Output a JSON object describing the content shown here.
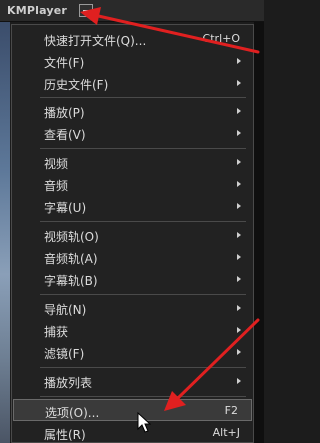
{
  "window": {
    "title": "KMPlayer"
  },
  "menu": {
    "items": [
      {
        "label": "快速打开文件(Q)...",
        "shortcut": "Ctrl+O",
        "submenu": false
      },
      {
        "label": "文件(F)",
        "shortcut": "",
        "submenu": true
      },
      {
        "label": "历史文件(F)",
        "shortcut": "",
        "submenu": true
      },
      {
        "label": "播放(P)",
        "shortcut": "",
        "submenu": true
      },
      {
        "label": "查看(V)",
        "shortcut": "",
        "submenu": true
      },
      {
        "label": "视频",
        "shortcut": "",
        "submenu": true
      },
      {
        "label": "音频",
        "shortcut": "",
        "submenu": true
      },
      {
        "label": "字幕(U)",
        "shortcut": "",
        "submenu": true
      },
      {
        "label": "视频轨(O)",
        "shortcut": "",
        "submenu": true
      },
      {
        "label": "音频轨(A)",
        "shortcut": "",
        "submenu": true
      },
      {
        "label": "字幕轨(B)",
        "shortcut": "",
        "submenu": true
      },
      {
        "label": "导航(N)",
        "shortcut": "",
        "submenu": true
      },
      {
        "label": "捕获",
        "shortcut": "",
        "submenu": true
      },
      {
        "label": "滤镜(F)",
        "shortcut": "",
        "submenu": true
      },
      {
        "label": "播放列表",
        "shortcut": "",
        "submenu": true
      },
      {
        "label": "选项(O)...",
        "shortcut": "F2",
        "submenu": false,
        "highlighted": true
      },
      {
        "label": "属性(R)",
        "shortcut": "Alt+J",
        "submenu": false
      }
    ]
  },
  "colors": {
    "annotation_arrow": "#e02020",
    "menu_background": "#222222",
    "highlight": "#3a3a3a"
  },
  "icons": [
    "menu-button-icon",
    "submenu-arrow-icon",
    "mouse-cursor-icon"
  ]
}
